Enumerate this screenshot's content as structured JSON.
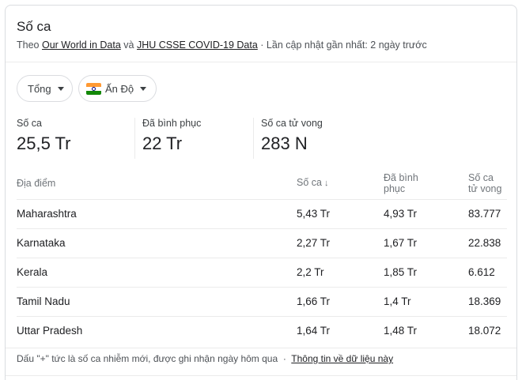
{
  "title": "Số ca",
  "source": {
    "prefix": "Theo",
    "link1": "Our World in Data",
    "and": "và",
    "link2": "JHU CSSE COVID-19 Data",
    "updated": "· Lần cập nhật gần nhất: 2 ngày trước"
  },
  "filters": {
    "total_label": "Tổng",
    "country_label": "Ấn Độ",
    "country_flag": "india-flag-icon"
  },
  "stats": [
    {
      "label": "Số ca",
      "value": "25,5 Tr"
    },
    {
      "label": "Đã bình phục",
      "value": "22 Tr"
    },
    {
      "label": "Số ca tử vong",
      "value": "283 N"
    }
  ],
  "table": {
    "headers": {
      "location": "Địa điểm",
      "cases": "Số ca",
      "recovered_line1": "Đã bình",
      "recovered_line2": "phục",
      "deaths_line1": "Số ca",
      "deaths_line2": "tử vong",
      "sort_icon": "↓"
    },
    "rows": [
      {
        "location": "Maharashtra",
        "cases": "5,43 Tr",
        "recovered": "4,93 Tr",
        "deaths": "83.777"
      },
      {
        "location": "Karnataka",
        "cases": "2,27 Tr",
        "recovered": "1,67 Tr",
        "deaths": "22.838"
      },
      {
        "location": "Kerala",
        "cases": "2,2 Tr",
        "recovered": "1,85 Tr",
        "deaths": "6.612"
      },
      {
        "location": "Tamil Nadu",
        "cases": "1,66 Tr",
        "recovered": "1,4 Tr",
        "deaths": "18.369"
      },
      {
        "location": "Uttar Pradesh",
        "cases": "1,64 Tr",
        "recovered": "1,48 Tr",
        "deaths": "18.072"
      }
    ]
  },
  "footer": {
    "note": "Dấu \"+\" tức là số ca nhiễm mới, được ghi nhận ngày hôm qua",
    "separator": "·",
    "link": "Thông tin về dữ liệu này"
  },
  "colors": {
    "text": "#202124",
    "secondary": "#70757a",
    "border": "#dadce0"
  }
}
